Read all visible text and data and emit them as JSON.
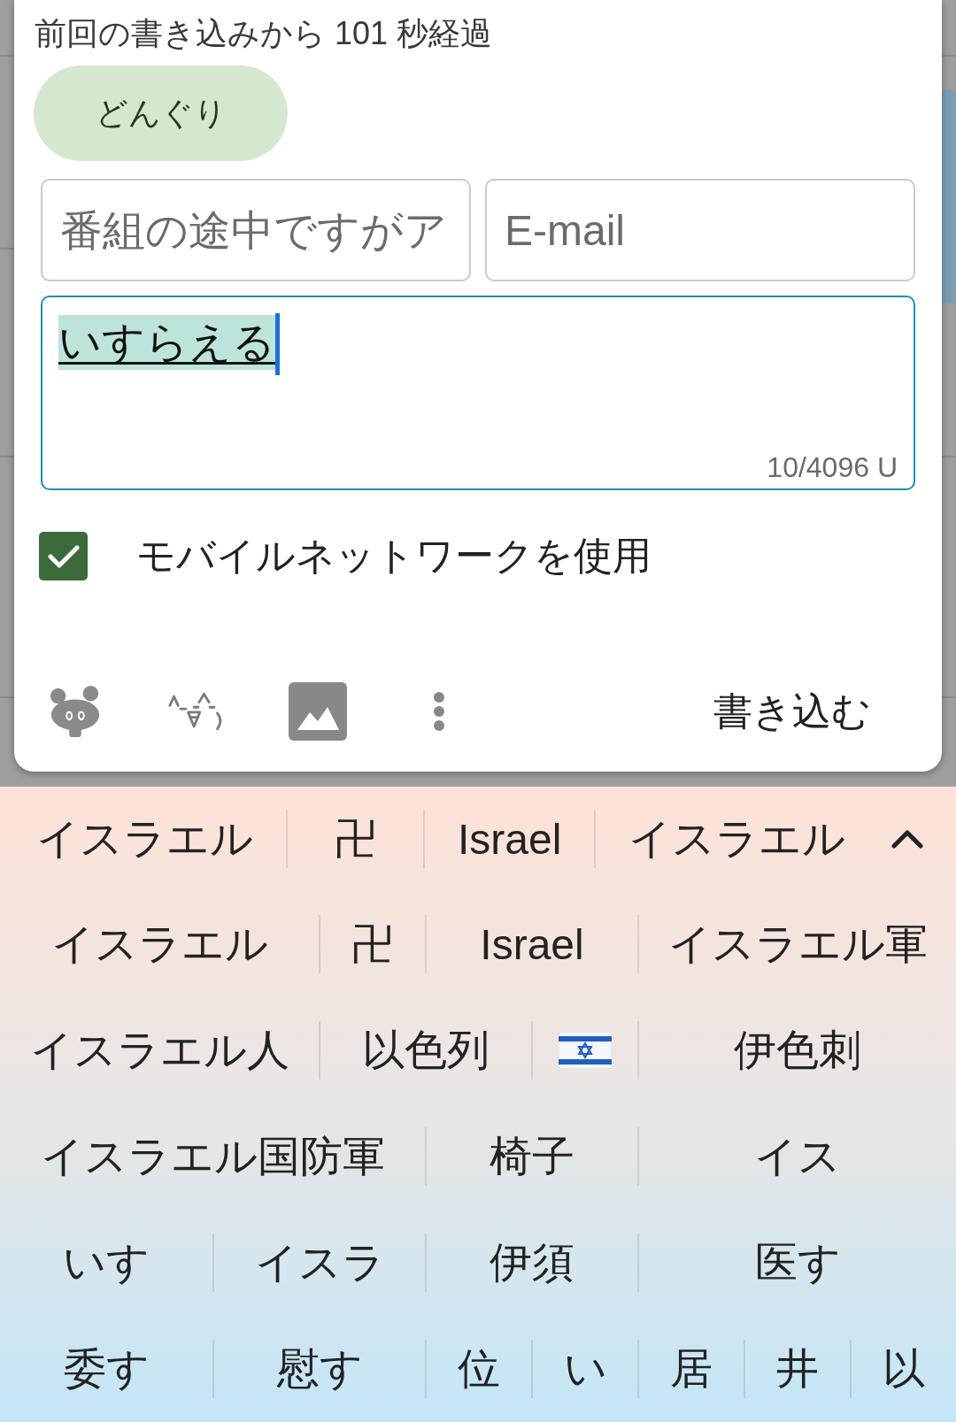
{
  "dialog": {
    "status": "前回の書き込みから 101 秒経過",
    "acorn_button": "どんぐり",
    "name_field": {
      "placeholder": "番組の途中ですがア"
    },
    "email_field": {
      "placeholder": "E-mail"
    },
    "message": {
      "value": "いすらえる",
      "composing": true,
      "counter": "10/4096 U"
    },
    "options": [
      {
        "label": "モバイルネットワークを使用",
        "checked": true
      }
    ],
    "tools": [
      {
        "kind": "creature"
      },
      {
        "kind": "emoticon"
      },
      {
        "kind": "image"
      },
      {
        "kind": "more"
      }
    ],
    "submit": "書き込む"
  },
  "keyboard": {
    "suggestions": [
      "イスラエル",
      "卍",
      "Israel",
      "イスラエル"
    ],
    "expanded": true,
    "rows": [
      {
        "items": [
          {
            "kind": "word",
            "text": "イスラエル"
          },
          {
            "kind": "word",
            "text": "卍"
          },
          {
            "kind": "word",
            "text": "Israel"
          },
          {
            "kind": "word",
            "text": "イスラエル軍"
          }
        ]
      },
      {
        "items": [
          {
            "kind": "word",
            "text": "イスラエル人"
          },
          {
            "kind": "word",
            "text": "以色列"
          },
          {
            "kind": "emoji"
          },
          {
            "kind": "word",
            "text": "伊色刺"
          }
        ]
      },
      {
        "items": [
          {
            "kind": "word",
            "text": "イスラエル国防軍"
          },
          {
            "kind": "word",
            "text": "椅子"
          },
          {
            "kind": "word",
            "text": "イス"
          }
        ]
      },
      {
        "items": [
          {
            "kind": "word",
            "text": "いす"
          },
          {
            "kind": "word",
            "text": "イスラ"
          },
          {
            "kind": "word",
            "text": "伊須"
          },
          {
            "kind": "word",
            "text": "医す"
          }
        ]
      },
      {
        "items": [
          {
            "kind": "word",
            "text": "委す"
          },
          {
            "kind": "word",
            "text": "慰す"
          },
          {
            "kind": "word",
            "text": "位"
          },
          {
            "kind": "word",
            "text": "い"
          },
          {
            "kind": "word",
            "text": "居"
          },
          {
            "kind": "word",
            "text": "井"
          },
          {
            "kind": "word",
            "text": "以"
          }
        ]
      }
    ]
  }
}
